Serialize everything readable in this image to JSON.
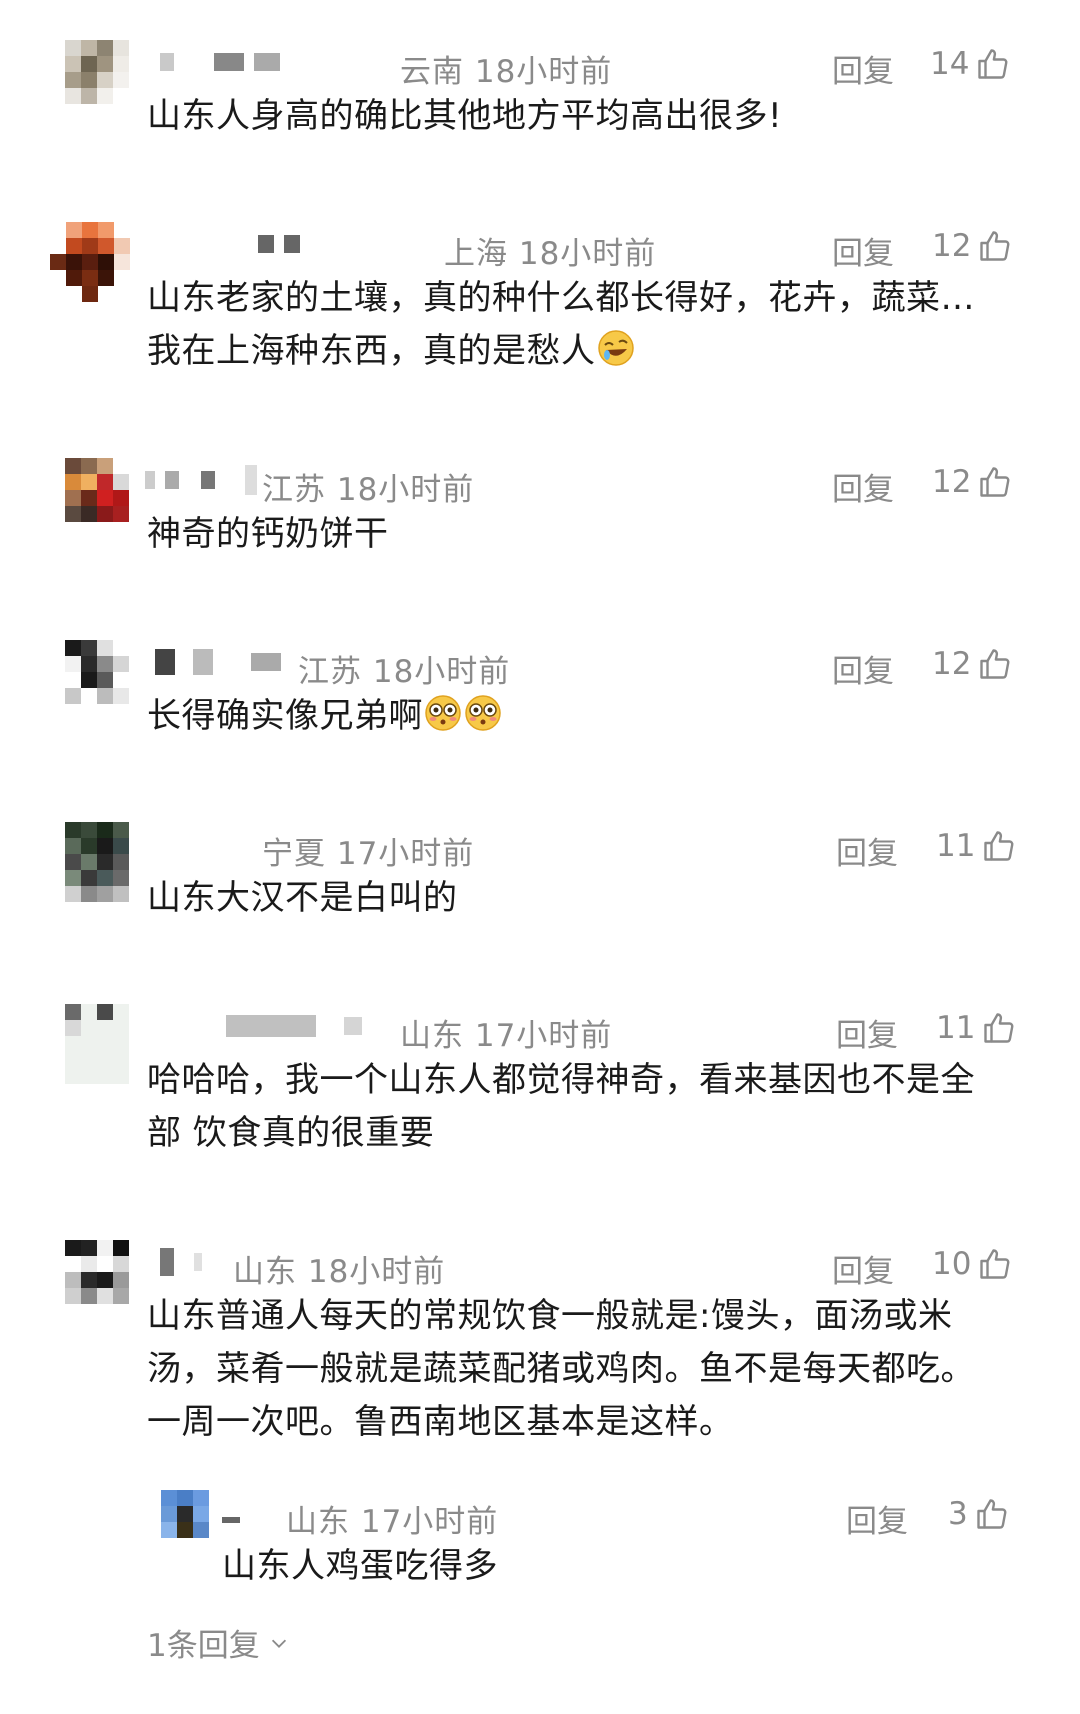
{
  "comments": [
    {
      "region": "云南",
      "time": "18小时前",
      "reply_label": "回复",
      "likes": "14",
      "text": "山东人身高的确比其他地方平均高出很多!"
    },
    {
      "region": "上海",
      "time": "18小时前",
      "reply_label": "回复",
      "likes": "12",
      "text_line1": "山东老家的土壤，真的种什么都长得好，花卉，蔬菜…",
      "text_line2": "我在上海种东西，真的是愁人"
    },
    {
      "region": "江苏",
      "time": "18小时前",
      "reply_label": "回复",
      "likes": "12",
      "text": "神奇的钙奶饼干"
    },
    {
      "region": "江苏",
      "time": "18小时前",
      "reply_label": "回复",
      "likes": "12",
      "text": "长得确实像兄弟啊"
    },
    {
      "region": "宁夏",
      "time": "17小时前",
      "reply_label": "回复",
      "likes": "11",
      "text": "山东大汉不是白叫的"
    },
    {
      "region": "山东",
      "time": "17小时前",
      "reply_label": "回复",
      "likes": "11",
      "text_line1": "哈哈哈，我一个山东人都觉得神奇，看来基因也不是全",
      "text_line2": "部 饮食真的很重要"
    },
    {
      "region": "山东",
      "time": "18小时前",
      "reply_label": "回复",
      "likes": "10",
      "text_line1": "山东普通人每天的常规饮食一般就是:馒头，面汤或米",
      "text_line2": "汤，菜肴一般就是蔬菜配猪或鸡肉。鱼不是每天都吃。",
      "text_line3": "一周一次吧。鲁西南地区基本是这样。"
    }
  ],
  "sub_reply": {
    "region": "山东",
    "time": "17小时前",
    "reply_label": "回复",
    "likes": "3",
    "text": "山东人鸡蛋吃得多"
  },
  "more_replies_label": "1条回复",
  "icons": {
    "like": "thumbs-up-icon",
    "expand": "chevron-down-icon",
    "emoji_laugh": "rolling-laugh-emoji-icon",
    "emoji_flushed": "flushed-face-emoji-icon"
  }
}
